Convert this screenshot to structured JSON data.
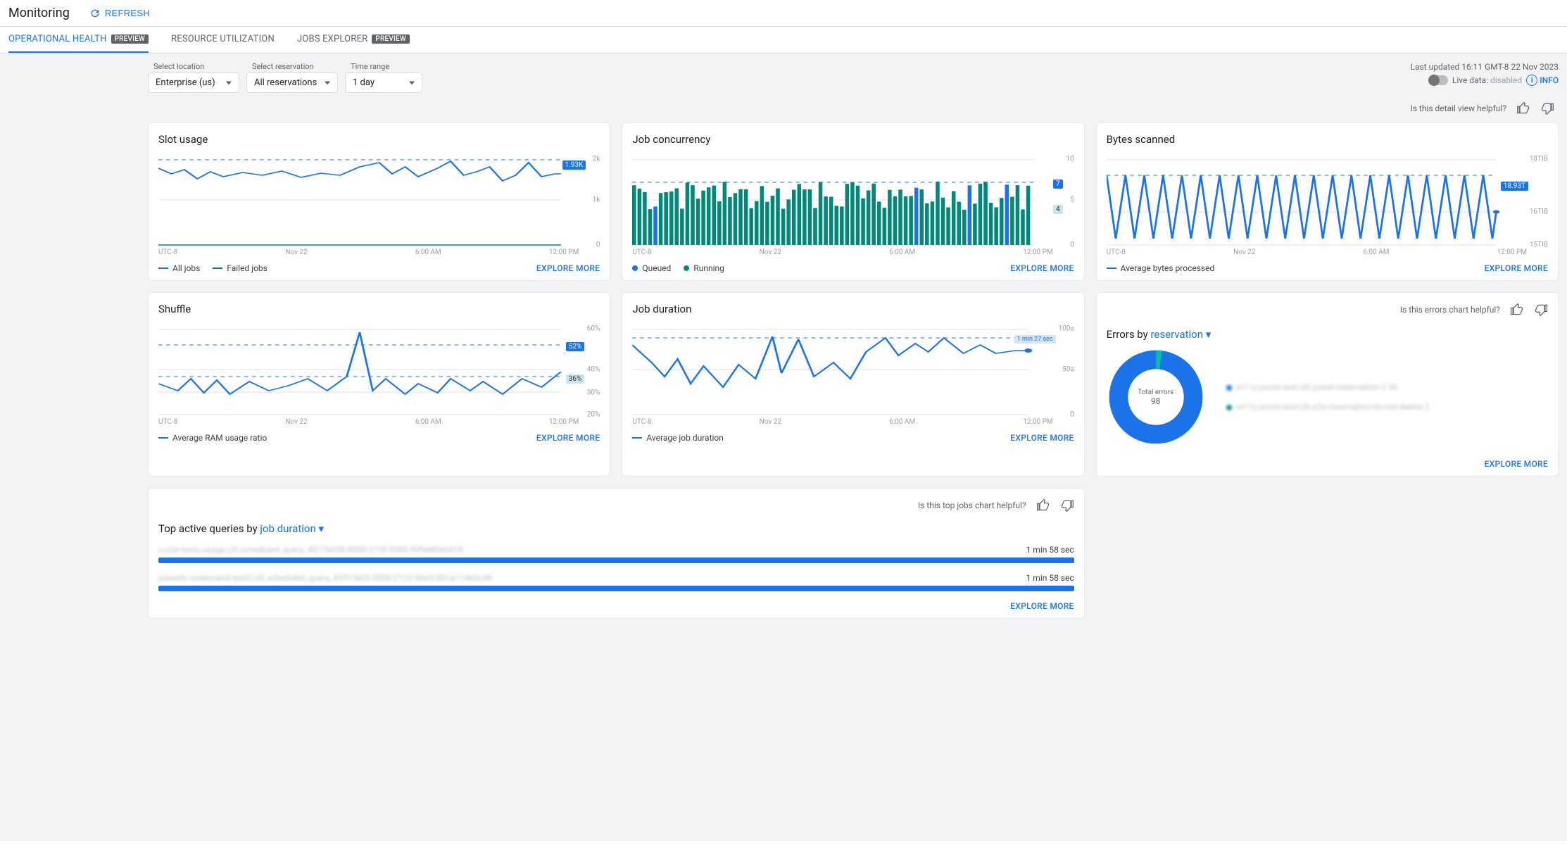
{
  "header": {
    "title": "Monitoring",
    "refresh": "REFRESH"
  },
  "tabs": [
    {
      "label": "OPERATIONAL HEALTH",
      "preview": "PREVIEW"
    },
    {
      "label": "RESOURCE UTILIZATION"
    },
    {
      "label": "JOBS EXPLORER",
      "preview": "PREVIEW"
    }
  ],
  "selects": {
    "location": {
      "label": "Select location",
      "value": "Enterprise (us)"
    },
    "reservation": {
      "label": "Select reservation",
      "value": "All reservations"
    },
    "time": {
      "label": "Time range",
      "value": "1 day"
    }
  },
  "status": {
    "updated": "Last updated 16:11 GMT-8 22 Nov 2023",
    "live_label": "Live data:",
    "live_state": "disabled",
    "info": "INFO"
  },
  "feedback": {
    "detail": "Is this detail view helpful?",
    "errors": "Is this errors chart helpful?",
    "topjobs": "Is this top jobs chart helpful?"
  },
  "explore": "EXPLORE MORE",
  "xaxis": [
    "UTC-8",
    "Nov 22",
    "6:00 AM",
    "12:00 PM"
  ],
  "cards": {
    "slot": {
      "title": "Slot usage",
      "ylabels": {
        "top": "2k",
        "mid": "1k",
        "bot": "0"
      },
      "badge": "1.93K",
      "legend": [
        "All jobs",
        "Failed jobs"
      ]
    },
    "concurrency": {
      "title": "Job concurrency",
      "ylabels": {
        "top": "10",
        "mid": "5",
        "bot": "0"
      },
      "badge1": "7",
      "badge2": "4",
      "legend": [
        "Queued",
        "Running"
      ]
    },
    "bytes": {
      "title": "Bytes scanned",
      "ylabels": {
        "top": "18TIB",
        "mid": "16TIB",
        "bot": "15TIB"
      },
      "badge": "18.93T",
      "legend": [
        "Average bytes processed"
      ]
    },
    "shuffle": {
      "title": "Shuffle",
      "ylabels": {
        "t1": "60%",
        "t2": "40%",
        "t3": "30%",
        "t4": "20%"
      },
      "badge1": "52%",
      "badge2": "36%",
      "legend": [
        "Average RAM usage ratio"
      ]
    },
    "duration": {
      "title": "Job duration",
      "ylabels": {
        "top": "100s",
        "mid": "50s",
        "bot": "0"
      },
      "badge": "1 min 27 sec",
      "legend": [
        "Average job duration"
      ]
    },
    "errors": {
      "title_prefix": "Errors by ",
      "title_link": "reservation",
      "center_label": "Total errors",
      "center_value": "98",
      "items": [
        "m11y-jxonix-test.US.yuesh-reservation-2 96",
        "m11y-jxonix-test.US.e2e-reservation-do-not-delete 2"
      ]
    }
  },
  "topqueries": {
    "title_prefix": "Top active queries by ",
    "title_link": "job duration",
    "rows": [
      {
        "name": "u-e2e-tests-usage.US.scheduled_query_4577b058-8000-273f-9385-f6f9e8045418",
        "time": "1 min 58 sec",
        "pct": 100
      },
      {
        "name": "juliawhr-ondemand-test3.US.scheduled_query_65915af3-0000-2122-96e5-001a114e5c98",
        "time": "1 min 58 sec",
        "pct": 100
      }
    ]
  },
  "chart_data": [
    {
      "type": "line",
      "title": "Slot usage",
      "ylim": [
        0,
        2000
      ],
      "latest": 1930,
      "series": [
        {
          "name": "All jobs"
        },
        {
          "name": "Failed jobs"
        }
      ]
    },
    {
      "type": "bar",
      "title": "Job concurrency",
      "ylim": [
        0,
        10
      ],
      "series": [
        {
          "name": "Queued",
          "latest": 7
        },
        {
          "name": "Running",
          "latest": 4
        }
      ]
    },
    {
      "type": "line",
      "title": "Bytes scanned",
      "ylim": [
        15,
        18
      ],
      "unit": "TiB",
      "latest": 18.93,
      "series": [
        {
          "name": "Average bytes processed"
        }
      ]
    },
    {
      "type": "line",
      "title": "Shuffle",
      "ylim": [
        20,
        60
      ],
      "unit": "%",
      "latest": 52,
      "series": [
        {
          "name": "Average RAM usage ratio"
        }
      ]
    },
    {
      "type": "line",
      "title": "Job duration",
      "ylim": [
        0,
        100
      ],
      "unit": "s",
      "latest": 87,
      "series": [
        {
          "name": "Average job duration"
        }
      ]
    },
    {
      "type": "pie",
      "title": "Errors by reservation",
      "series": [
        {
          "name": "yuesh-reservation-2",
          "value": 96
        },
        {
          "name": "e2e-reservation-do-not-delete",
          "value": 2
        }
      ],
      "total": 98
    }
  ]
}
